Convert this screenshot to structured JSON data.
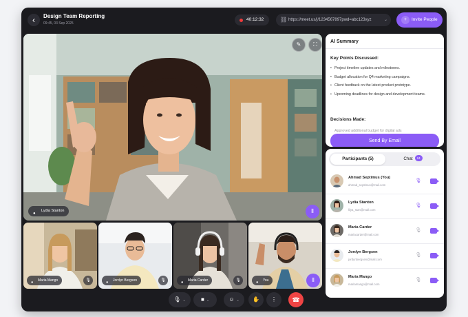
{
  "header": {
    "back_icon": "chevron-left-icon",
    "title": "Design Team Reporting",
    "subtitle": "09:45, 03 Sep 2025",
    "timer": "40:12:32",
    "meeting_url": "https://meet.us/j/1234567897pwd=abc123xyz",
    "invite_label": "Invite People"
  },
  "main_video": {
    "speaker_name": "Lydia Stanton"
  },
  "tiles": [
    {
      "name": "Maria Mango"
    },
    {
      "name": "Jordyn Bergson"
    },
    {
      "name": "Maria Carder"
    },
    {
      "name": "You"
    }
  ],
  "summary": {
    "title": "AI Summary",
    "key_points_heading": "Key Points Discussed:",
    "key_points": [
      "Project timeline updates and milestones.",
      "Budget allocation for Q4 marketing campaigns.",
      "Client feedback on the latest product prototype.",
      "Upcoming deadlines for design and development teams."
    ],
    "decisions_heading": "Decisions Made:",
    "decision_partial": "Approved additional budget for digital ads",
    "send_label": "Send By Email"
  },
  "panel": {
    "tab_participants": "Participants (5)",
    "tab_chat": "Chat",
    "chat_count": "24",
    "participants": [
      {
        "name": "Ahmad Septimus  (You)",
        "email": "ahmad_septimus@mail.com",
        "mic_on": true,
        "cam_on": true
      },
      {
        "name": "Lydia Stanton",
        "email": "lilya_stan@mail.com",
        "mic_on": true,
        "cam_on": true
      },
      {
        "name": "Maria Carder",
        "email": "mariacarder@mail.com",
        "mic_on": false,
        "cam_on": true
      },
      {
        "name": "Jordyn Bergsen",
        "email": "jordynbergsen@mail.com",
        "mic_on": false,
        "cam_on": true
      },
      {
        "name": "Maria Mango",
        "email": "mariamango@mail.com",
        "mic_on": false,
        "cam_on": true
      }
    ]
  },
  "colors": {
    "accent": "#8b5cf6",
    "danger": "#ef4444",
    "frame": "#1b1b1f"
  }
}
